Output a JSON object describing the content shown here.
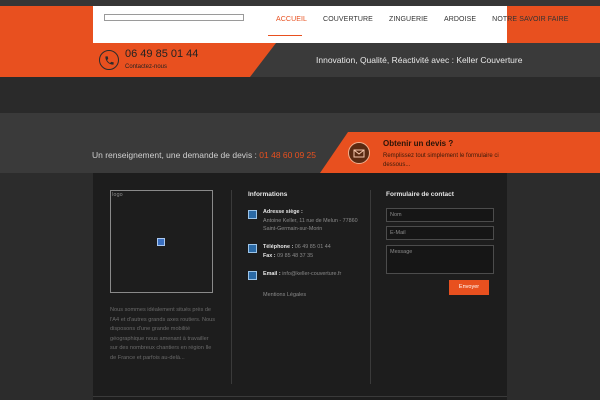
{
  "header": {
    "nav": [
      "ACCUEIL",
      "COUVERTURE",
      "ZINGUERIE",
      "ARDOISE",
      "NOTRE SAVOIR FAIRE"
    ],
    "phone": "06 49 85 01 44",
    "contact_label": "Contactez-nous",
    "tagline": "Innovation, Qualité, Réactivité avec : Keller Couverture"
  },
  "info_bar": {
    "text": "Un renseignement, une demande de devis :",
    "phone": "01 48 60 09 25"
  },
  "devis": {
    "title": "Obtenir un devis ?",
    "subtitle": "Remplissez tout simplement le formulaire ci dessous..."
  },
  "footer": {
    "logo_alt": "logo",
    "about": "Nous sommes idéalement situés près de l'A4 et d'autres grands axes routiers. Nous disposons d'une grande mobilité géographique nous amenant à travailler sur des nombreux chantiers en région Ile de France et parfois au-delà...",
    "informations": {
      "title": "Informations",
      "address_label": "Adresse siège :",
      "address": "Antoine Keller, 11 rue de Melun - 77860 Saint-Germain-sur-Morin",
      "phone_label": "Téléphone :",
      "phone": "06 49 85 01 44",
      "fax_label": "Fax :",
      "fax": "09 85 48 37 35",
      "email_label": "Email :",
      "email": "info@keller-couverture.fr",
      "mentions": "Mentions Légales"
    },
    "form": {
      "title": "Formulaire de contact",
      "name_placeholder": "Nom",
      "email_placeholder": "E-Mail",
      "message_placeholder": "Message",
      "submit": "Envoyer"
    }
  },
  "colors": {
    "accent": "#e8501f",
    "dark": "#1d1d1d"
  }
}
